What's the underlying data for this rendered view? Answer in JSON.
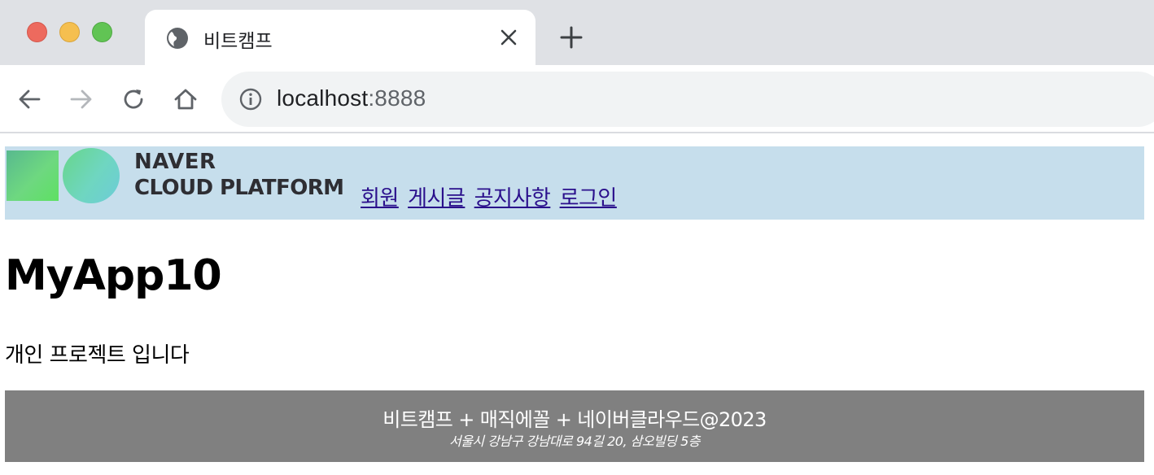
{
  "browser": {
    "tab_title": "비트캠프",
    "url_host": "localhost",
    "url_port": ":8888"
  },
  "header": {
    "logo_line1": "NAVER",
    "logo_line2": "CLOUD PLATFORM",
    "menu": [
      {
        "label": "회원"
      },
      {
        "label": "게시글"
      },
      {
        "label": "공지사항"
      },
      {
        "label": "로그인"
      }
    ],
    "background": "#c6deec",
    "link_color": "#2a0f8c"
  },
  "main": {
    "title": "MyApp10",
    "intro": "개인 프로젝트 입니다"
  },
  "footer": {
    "main_text": "비트캠프 + 매직에꼴 + 네이버클라우드@2023",
    "address": "서울시 강남구 강남대로 94길 20, 삼오빌딩 5층",
    "background": "#808080"
  }
}
